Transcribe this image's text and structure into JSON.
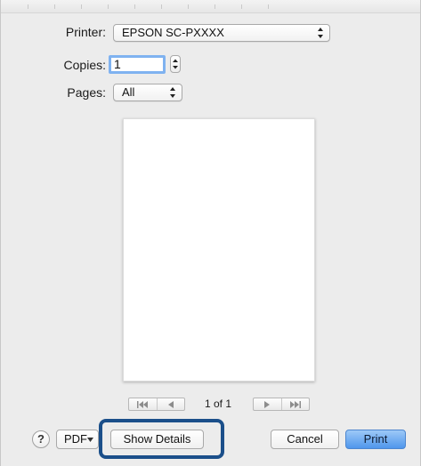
{
  "printer": {
    "label": "Printer:",
    "value": "EPSON SC-PXXXX"
  },
  "copies": {
    "label": "Copies:",
    "value": "1"
  },
  "pages": {
    "label": "Pages:",
    "value": "All"
  },
  "preview_nav": {
    "first_icon": "first-page-icon",
    "prev_icon": "previous-page-icon",
    "next_icon": "next-page-icon",
    "last_icon": "last-page-icon",
    "page_count": "1 of 1"
  },
  "footer": {
    "help_label": "?",
    "pdf_label": "PDF",
    "show_details_label": "Show Details",
    "cancel_label": "Cancel",
    "print_label": "Print"
  },
  "colors": {
    "highlight": "#1b4f8a",
    "print_button": "#4f96ec",
    "focus_ring": "#7fb2f0"
  }
}
